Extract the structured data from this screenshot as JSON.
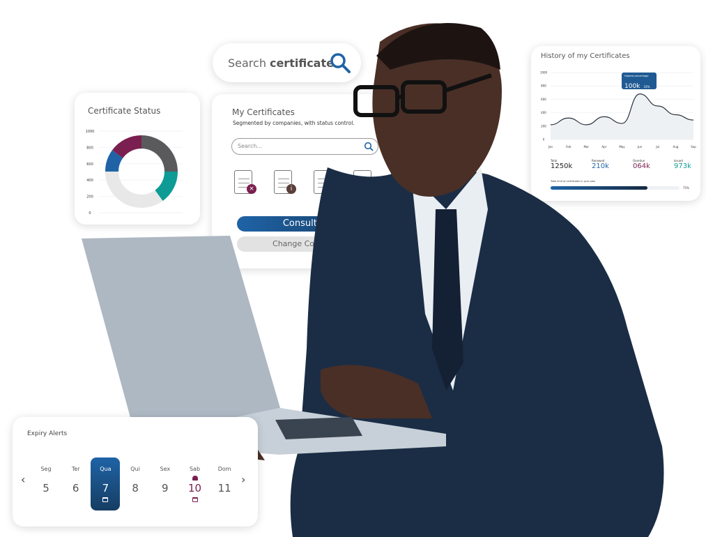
{
  "search_pill": {
    "prefix": "Search",
    "bold": "certificate"
  },
  "certificate_status": {
    "title": "Certificate Status"
  },
  "my_certificates": {
    "title": "My Certificates",
    "subtitle": "Segmented by companies, with status control.",
    "search_placeholder": "Search...",
    "consult_label": "Consult all",
    "change_label": "Change Company",
    "icons": [
      {
        "status": "error",
        "color": "#7a1f4f"
      },
      {
        "status": "info",
        "color": "#5a3f3a"
      },
      {
        "status": "ok",
        "color": "#0d6b6e"
      },
      {
        "status": "ok",
        "color": "#0d6b6e"
      }
    ]
  },
  "history": {
    "title": "History of my Certificates",
    "tooltip": {
      "label": "Highest percentage",
      "value": "100k",
      "delta": "33%"
    },
    "stats": [
      {
        "label": "Total",
        "value": "1250k",
        "color": "#222222"
      },
      {
        "label": "Renewed",
        "value": "210k",
        "color": "#1f63a6"
      },
      {
        "label": "Overdue",
        "value": "064k",
        "color": "#7a1f4f"
      },
      {
        "label": "Issued",
        "value": "973k",
        "color": "#0e9b95"
      }
    ],
    "limit": {
      "label": "Total limit of certificates in your plan",
      "percent_text": "75%",
      "fraction": 0.75
    }
  },
  "expiry": {
    "title": "Expiry Alerts",
    "days": [
      {
        "name": "Seg",
        "num": "5"
      },
      {
        "name": "Ter",
        "num": "6"
      },
      {
        "name": "Qua",
        "num": "7",
        "selected": true
      },
      {
        "name": "Qui",
        "num": "8"
      },
      {
        "name": "Sex",
        "num": "9"
      },
      {
        "name": "Sab",
        "num": "10",
        "alert": true
      },
      {
        "name": "Dom",
        "num": "11"
      }
    ]
  },
  "chart_data": [
    {
      "type": "pie",
      "title": "Certificate Status",
      "donut": true,
      "yticks": [
        0,
        200,
        400,
        600,
        800,
        1000
      ],
      "slices": [
        {
          "value": 25,
          "color": "#5a5a5c"
        },
        {
          "value": 15,
          "color": "#0e9b95"
        },
        {
          "value": 35,
          "color": "#e8e8e8"
        },
        {
          "value": 10,
          "color": "#1f63a6"
        },
        {
          "value": 15,
          "color": "#7a1f4f"
        }
      ]
    },
    {
      "type": "area",
      "title": "History of my Certificates",
      "categories": [
        "Jan",
        "Feb",
        "Mar",
        "Apr",
        "May",
        "Jun",
        "Jul",
        "Aug",
        "Sep"
      ],
      "values": [
        220,
        320,
        220,
        340,
        240,
        680,
        500,
        370,
        290
      ],
      "ylim": [
        0,
        1000
      ],
      "yticks": [
        0,
        200,
        400,
        600,
        800,
        1000
      ],
      "grid": true
    }
  ]
}
